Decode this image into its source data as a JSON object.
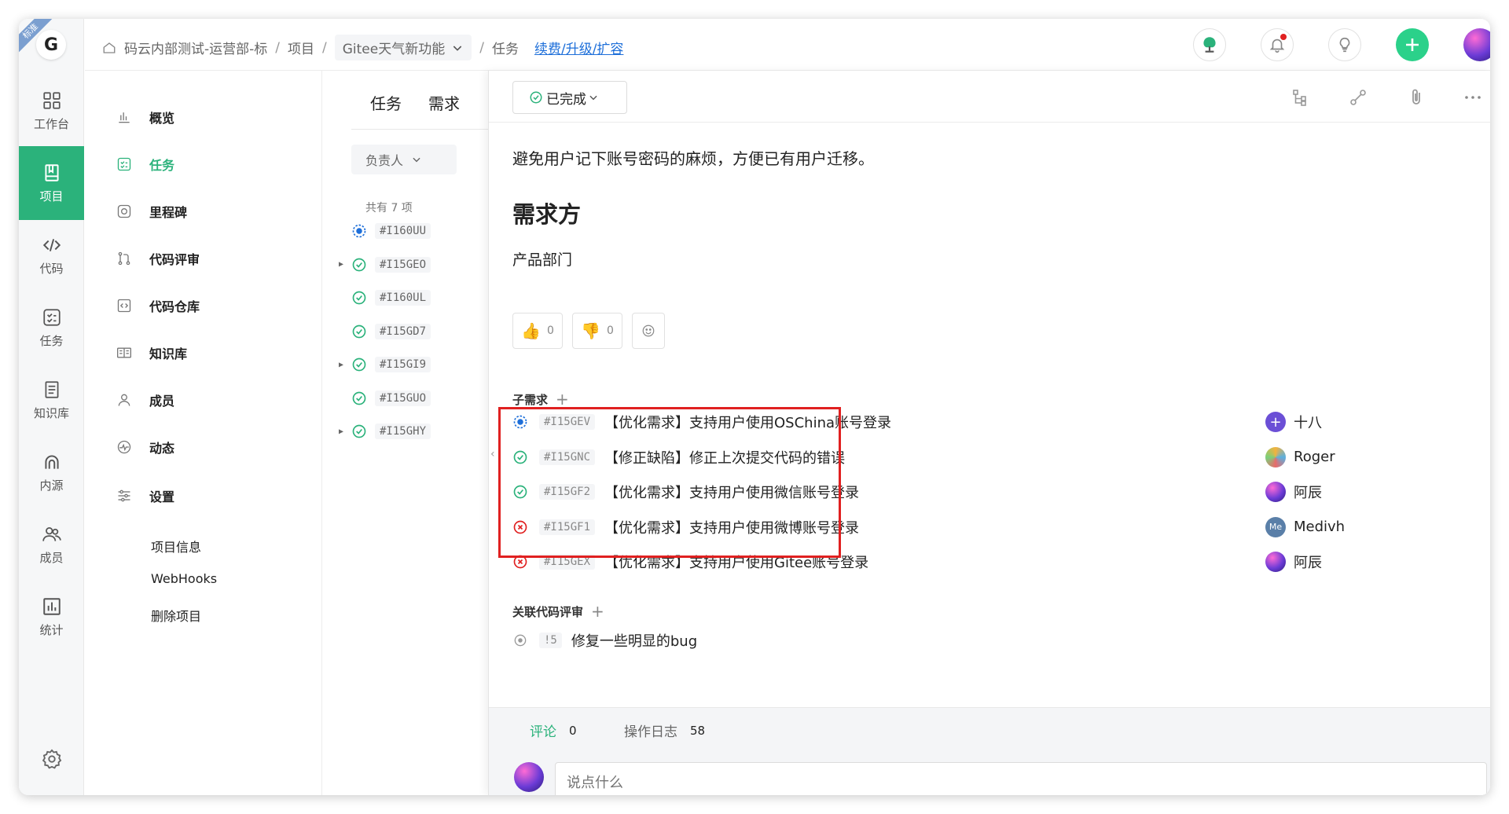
{
  "ribbon": "标准",
  "logo": "G",
  "rail": [
    {
      "label": "工作台",
      "icon": "grid-icon"
    },
    {
      "label": "项目",
      "icon": "book-icon",
      "active": true
    },
    {
      "label": "代码",
      "icon": "code-icon"
    },
    {
      "label": "任务",
      "icon": "task-icon"
    },
    {
      "label": "知识库",
      "icon": "doc-icon"
    },
    {
      "label": "内源",
      "icon": "source-icon"
    },
    {
      "label": "成员",
      "icon": "members-icon"
    },
    {
      "label": "统计",
      "icon": "stats-icon"
    }
  ],
  "breadcrumb": {
    "org": "码云内部测试-运营部-标",
    "projects": "项目",
    "project": "Gitee天气新功能",
    "section": "任务",
    "upgrade_link": "续费/升级/扩容"
  },
  "nav": {
    "items": [
      {
        "label": "概览",
        "icon": "chart-icon"
      },
      {
        "label": "任务",
        "icon": "task-icon",
        "active": true
      },
      {
        "label": "里程碑",
        "icon": "milestone-icon"
      },
      {
        "label": "代码评审",
        "icon": "review-icon"
      },
      {
        "label": "代码仓库",
        "icon": "repo-icon"
      },
      {
        "label": "知识库",
        "icon": "wiki-icon"
      },
      {
        "label": "成员",
        "icon": "member-icon"
      },
      {
        "label": "动态",
        "icon": "activity-icon"
      },
      {
        "label": "设置",
        "icon": "settings-icon"
      }
    ],
    "settings_sub": [
      "项目信息",
      "WebHooks",
      "删除项目"
    ]
  },
  "list": {
    "tabs": [
      "任务",
      "需求"
    ],
    "filter": "负责人",
    "count": "共有 7 项",
    "rows": [
      {
        "id": "#I160UU",
        "status": "in-progress",
        "expandable": false
      },
      {
        "id": "#I15GEO",
        "status": "done",
        "expandable": true
      },
      {
        "id": "#I160UL",
        "status": "done",
        "expandable": false
      },
      {
        "id": "#I15GD7",
        "status": "done",
        "expandable": false
      },
      {
        "id": "#I15GI9",
        "status": "done",
        "expandable": true
      },
      {
        "id": "#I15GUO",
        "status": "done",
        "expandable": false
      },
      {
        "id": "#I15GHY",
        "status": "done",
        "expandable": true
      }
    ]
  },
  "detail": {
    "status": "已完成",
    "description": "避免用户记下账号密码的麻烦，方便已有用户迁移。",
    "heading": "需求方",
    "requester": "产品部门",
    "reactions": {
      "up": "0",
      "down": "0"
    },
    "sub_title": "子需求",
    "subtasks": [
      {
        "id": "#I15GEV",
        "title": "【优化需求】支持用户使用OSChina账号登录",
        "status": "in-progress",
        "user": "十八",
        "avatar": "plus"
      },
      {
        "id": "#I15GNC",
        "title": "【修正缺陷】修正上次提交代码的错误",
        "status": "done",
        "user": "Roger",
        "avatar": "pattern"
      },
      {
        "id": "#I15GF2",
        "title": "【优化需求】支持用户使用微信账号登录",
        "status": "done",
        "user": "阿辰",
        "avatar": "galaxy"
      },
      {
        "id": "#I15GF1",
        "title": "【优化需求】支持用户使用微博账号登录",
        "status": "rejected",
        "user": "Medivh",
        "avatar": "Me"
      },
      {
        "id": "#I15GEX",
        "title": "【优化需求】支持用户使用Gitee账号登录",
        "status": "rejected",
        "user": "阿辰",
        "avatar": "galaxy"
      }
    ],
    "review_title": "关联代码评审",
    "reviews": [
      {
        "id": "!5",
        "title": "修复一些明显的bug"
      }
    ],
    "tabs": [
      {
        "label": "评论",
        "count": "0",
        "active": true
      },
      {
        "label": "操作日志",
        "count": "58",
        "active": false
      }
    ],
    "comment_placeholder": "说点什么"
  },
  "colors": {
    "accent": "#2bb27b",
    "in_progress": "#1e6fd9",
    "rejected": "#e02020",
    "highlight": "#e02020"
  }
}
